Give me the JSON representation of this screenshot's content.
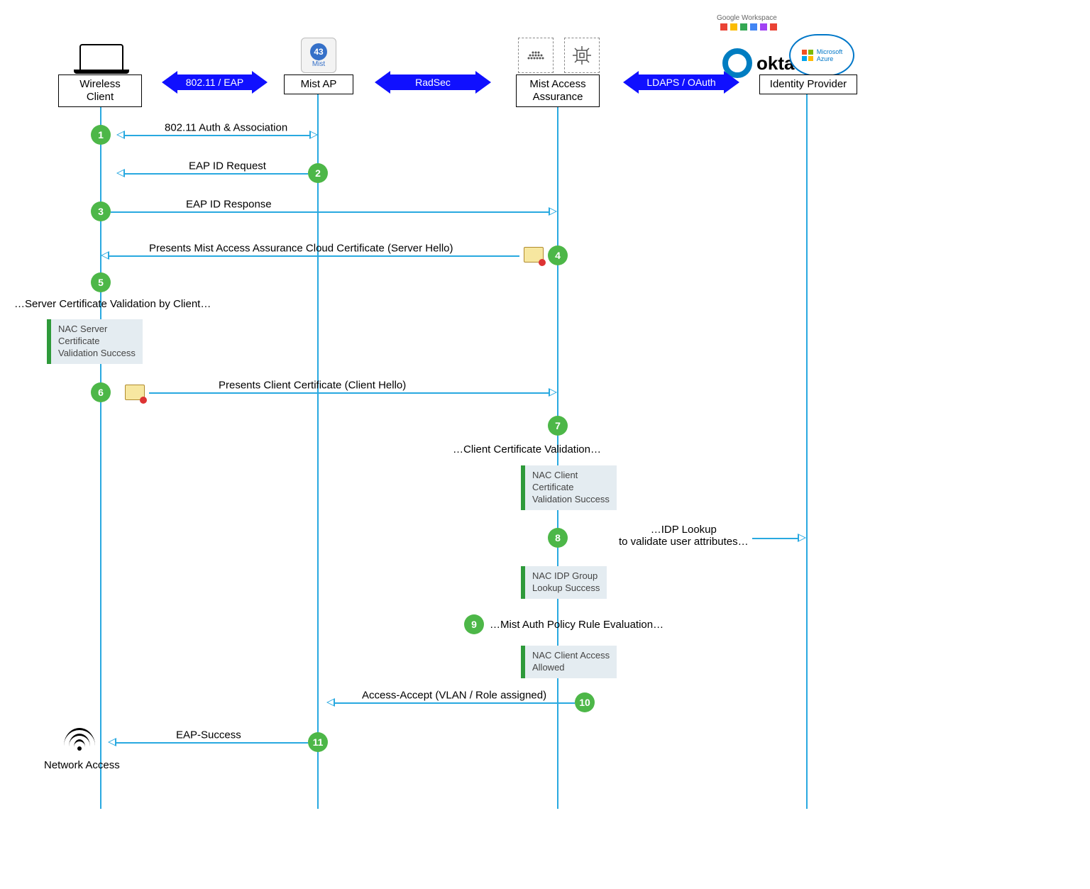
{
  "actors": {
    "client": "Wireless Client",
    "ap": "Mist AP",
    "maa": "Mist Access\nAssurance",
    "idp": "Identity Provider"
  },
  "protocols": {
    "p1": "802.11 / EAP",
    "p2": "RadSec",
    "p3": "LDAPS / OAuth"
  },
  "steps": {
    "s1": "1",
    "s2": "2",
    "s3": "3",
    "s4": "4",
    "s5": "5",
    "s6": "6",
    "s7": "7",
    "s8": "8",
    "s9": "9",
    "s10": "10",
    "s11": "11"
  },
  "messages": {
    "m1": "802.11 Auth & Association",
    "m2": "EAP ID Request",
    "m3": "EAP ID Response",
    "m4": "Presents Mist Access Assurance Cloud Certificate (Server Hello)",
    "m6": "Presents Client Certificate (Client Hello)",
    "m10": "Access-Accept (VLAN / Role assigned)",
    "m11": "EAP-Success"
  },
  "notes": {
    "n5": "…Server Certificate Validation by Client…",
    "n7": "…Client Certificate Validation…",
    "n8": "…IDP Lookup\nto validate user attributes…",
    "n9": "…Mist Auth Policy Rule Evaluation…",
    "network": "Network Access"
  },
  "status": {
    "st5": "NAC Server\nCertificate\nValidation Success",
    "st7": "NAC Client\nCertificate\nValidation Success",
    "st8": "NAC IDP Group\nLookup Success",
    "st9": "NAC Client Access\nAllowed"
  },
  "logos": {
    "ap_text": "Mist",
    "ap_num": "43",
    "okta": "okta",
    "azure": "Microsoft\nAzure",
    "gws": "Google Workspace"
  }
}
